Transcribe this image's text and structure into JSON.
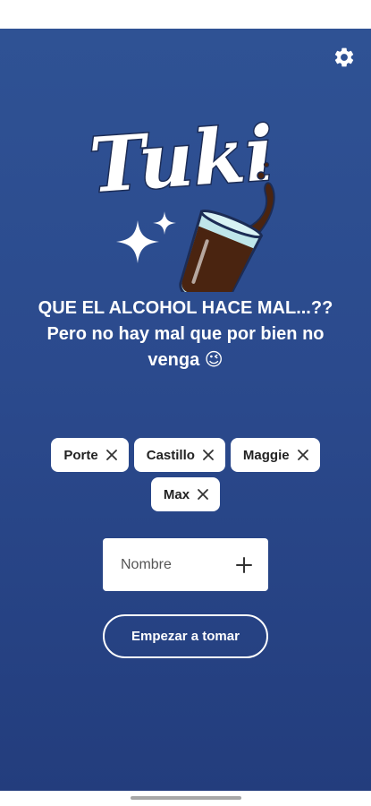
{
  "app": {
    "logo_text": "Tuki"
  },
  "tagline": "QUE EL ALCOHOL HACE MAL...?? Pero no hay mal que por bien no venga 😉",
  "players": [
    "Porte",
    "Castillo",
    "Maggie",
    "Max"
  ],
  "name_input": {
    "placeholder": "Nombre",
    "value": ""
  },
  "start_button": {
    "label": "Empezar a tomar"
  },
  "colors": {
    "background": "#2b4a8d",
    "chip": "#ffffff",
    "glass_liquid": "#4a2410"
  },
  "icons": {
    "settings": "gear-icon",
    "remove": "close-icon",
    "add": "plus-icon"
  }
}
